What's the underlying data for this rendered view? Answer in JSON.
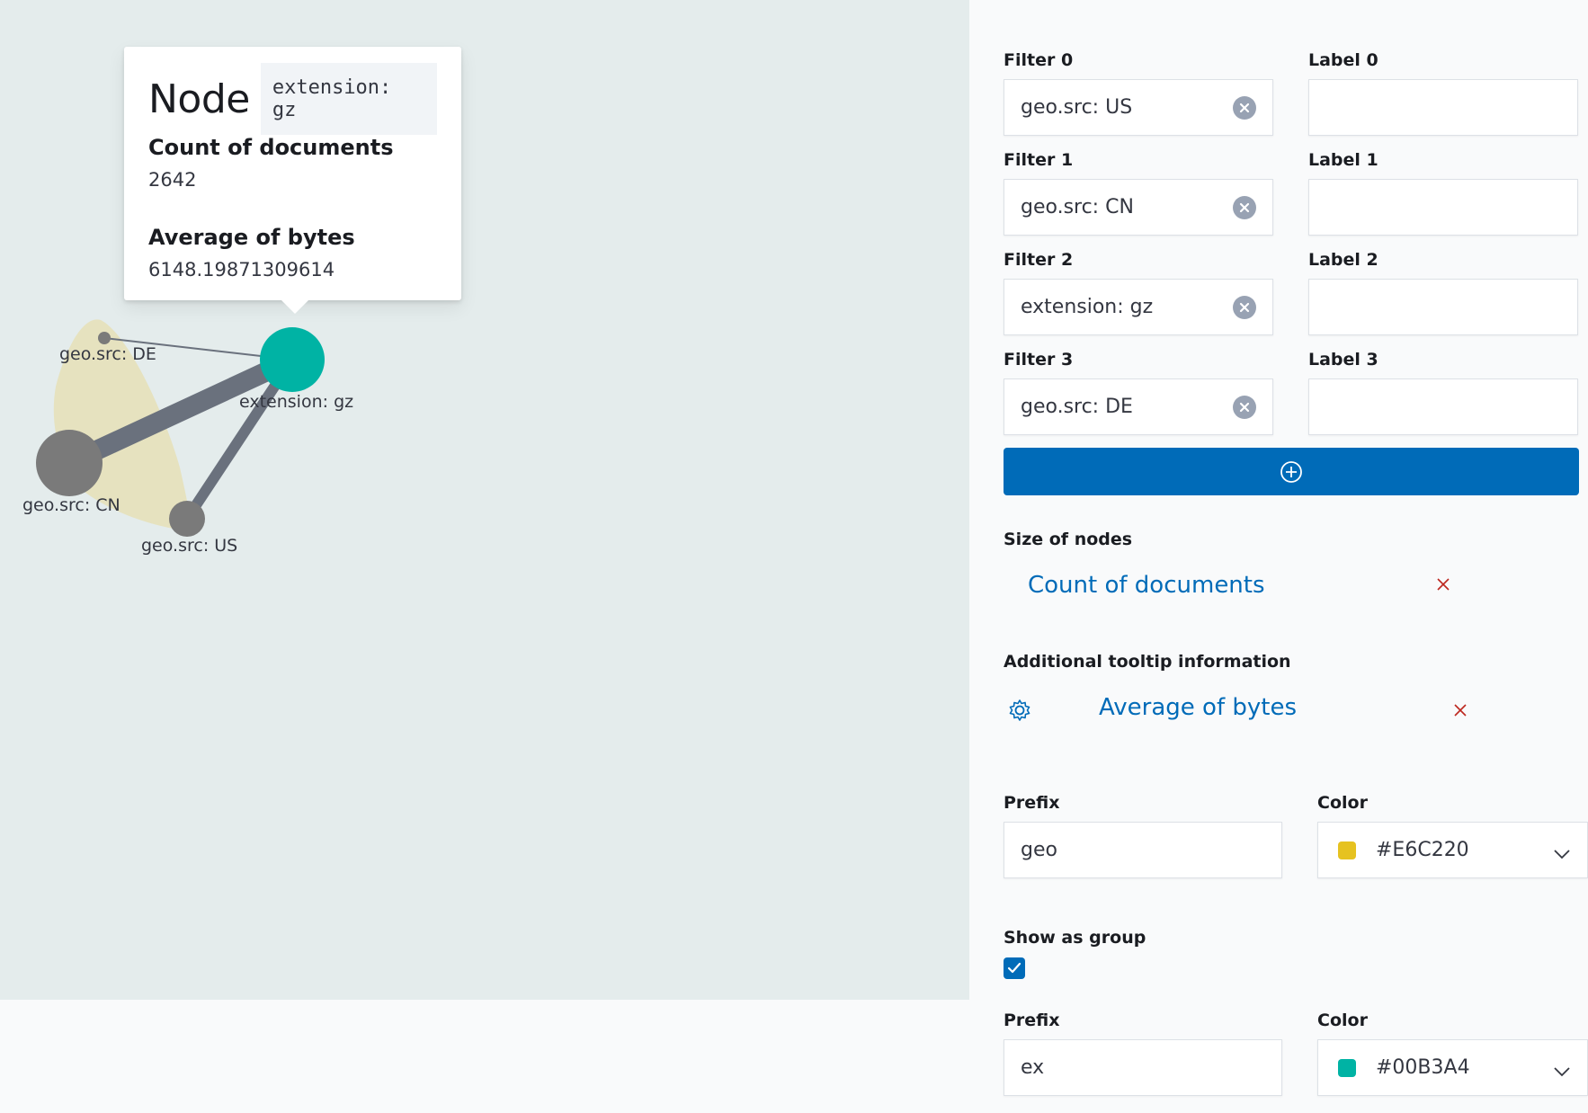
{
  "tooltip": {
    "title": "Node",
    "node_term": "extension: gz",
    "metrics": [
      {
        "label": "Count of documents",
        "value": "2642"
      },
      {
        "label": "Average of bytes",
        "value": "6148.19871309614"
      }
    ]
  },
  "graph": {
    "nodes": [
      {
        "label": "geo.src: DE"
      },
      {
        "label": "extension: gz"
      },
      {
        "label": "geo.src: CN"
      },
      {
        "label": "geo.src: US"
      }
    ],
    "colors": {
      "highlight": "#00B3A4",
      "node": "#7a7a7a",
      "edge": "#6a717d",
      "group_hull": "#E6C220"
    }
  },
  "filters": [
    {
      "filter_label": "Filter 0",
      "value": "geo.src: US",
      "label_label": "Label 0",
      "label_value": ""
    },
    {
      "filter_label": "Filter 1",
      "value": "geo.src: CN",
      "label_label": "Label 1",
      "label_value": ""
    },
    {
      "filter_label": "Filter 2",
      "value": "extension: gz",
      "label_label": "Label 2",
      "label_value": ""
    },
    {
      "filter_label": "Filter 3",
      "value": "geo.src: DE",
      "label_label": "Label 3",
      "label_value": ""
    }
  ],
  "add_filter_icon": "plus-circle-icon",
  "size_of_nodes": {
    "label": "Size of nodes",
    "value": "Count of documents"
  },
  "tooltip_info": {
    "label": "Additional tooltip information",
    "value": "Average of bytes"
  },
  "groups": [
    {
      "prefix_label": "Prefix",
      "prefix": "geo",
      "color_label": "Color",
      "color": "#E6C220",
      "show_as_group_label": "Show as group",
      "show_as_group": true
    },
    {
      "prefix_label": "Prefix",
      "prefix": "ex",
      "color_label": "Color",
      "color": "#00B3A4"
    }
  ],
  "colors": {
    "primary": "#006BB8",
    "danger": "#BD271E"
  }
}
